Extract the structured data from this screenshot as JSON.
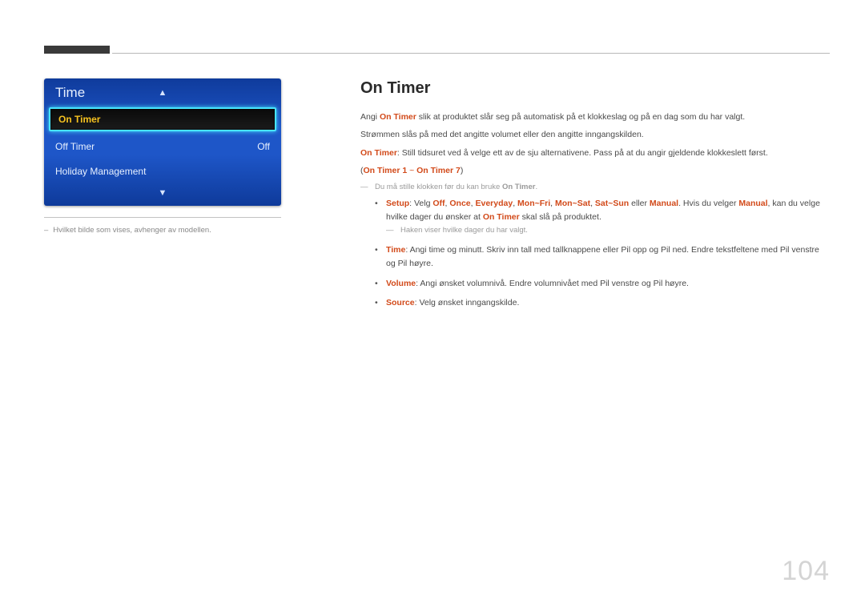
{
  "left": {
    "panel": {
      "title": "Time",
      "rows": [
        {
          "label": "On Timer",
          "value": "",
          "selected": true
        },
        {
          "label": "Off Timer",
          "value": "Off",
          "selected": false
        },
        {
          "label": "Holiday Management",
          "value": "",
          "selected": false
        }
      ]
    },
    "footnote_dash": "–",
    "footnote": "Hvilket bilde som vises, avhenger av modellen."
  },
  "article": {
    "heading": "On Timer",
    "p1_pre": "Angi ",
    "p1_hl": "On Timer",
    "p1_post": " slik at produktet slår seg på automatisk på et klokkeslag og på en dag som du har valgt.",
    "p2": "Strømmen slås på med det angitte volumet eller den angitte inngangskilden.",
    "p3_hl": "On Timer",
    "p3_post": ": Still tidsuret ved å velge ett av de sju alternativene. Pass på at du angir gjeldende klokkeslett først.",
    "range_open": "(",
    "range_a": "On Timer 1",
    "range_sep": " ~ ",
    "range_b": "On Timer 7",
    "range_close": ")",
    "note1_pre": "Du må stille klokken før du kan bruke ",
    "note1_hl": "On Timer",
    "note1_post": ".",
    "bullets": {
      "setup": {
        "label": "Setup",
        "pre": ": Velg ",
        "o1": "Off",
        "s1": ", ",
        "o2": "Once",
        "s2": ", ",
        "o3": "Everyday",
        "s3": ", ",
        "o4": "Mon~Fri",
        "s4": ", ",
        "o5": "Mon~Sat",
        "s5": ", ",
        "o6": "Sat~Sun",
        "s6": " eller ",
        "o7": "Manual",
        "post1": ". Hvis du velger ",
        "o7b": "Manual",
        "post2": ", kan du velge hvilke dager du ønsker at ",
        "hl_on": "On Timer",
        "post3": " skal slå på produktet.",
        "subnote": "Haken viser hvilke dager du har valgt."
      },
      "time": {
        "label": "Time",
        "text": ": Angi time og minutt. Skriv inn tall med tallknappene eller Pil opp og Pil ned. Endre tekstfeltene med Pil venstre og Pil høyre."
      },
      "volume": {
        "label": "Volume",
        "text": ": Angi ønsket volumnivå. Endre volumnivået med Pil venstre og Pil høyre."
      },
      "source": {
        "label": "Source",
        "text": ": Velg ønsket inngangskilde."
      }
    }
  },
  "page_number": "104"
}
